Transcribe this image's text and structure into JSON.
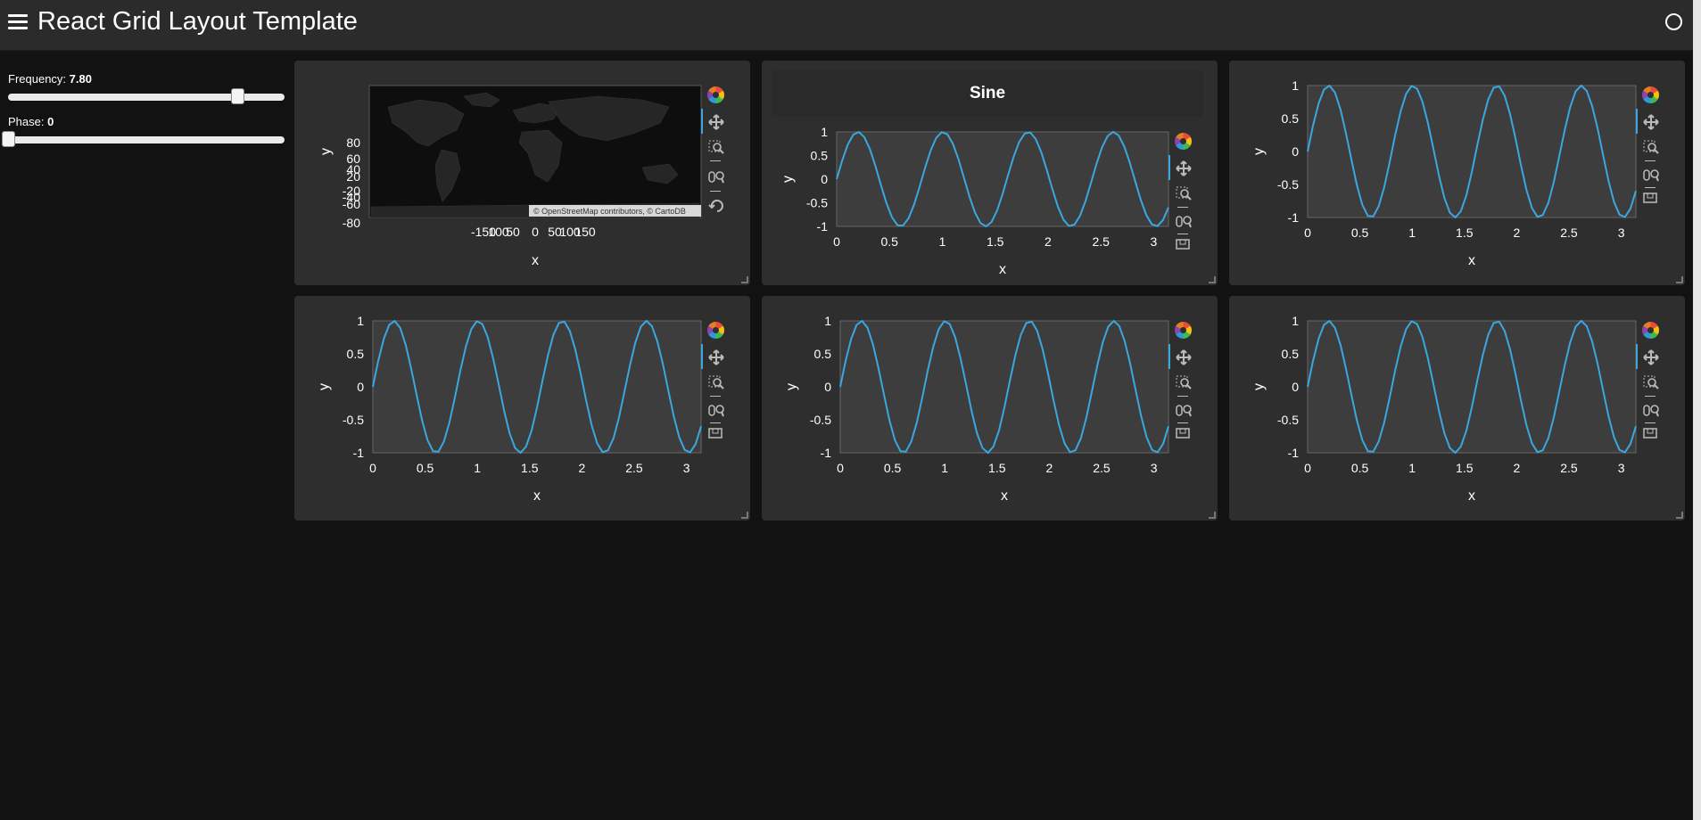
{
  "header": {
    "title": "React Grid Layout Template",
    "menu_icon": "hamburger-menu-icon",
    "status_icon": "busy-indicator-icon"
  },
  "sidebar": {
    "frequency": {
      "label": "Frequency:",
      "value": "7.80",
      "level": 0.83
    },
    "phase": {
      "label": "Phase:",
      "value": "0",
      "level": 0.0
    }
  },
  "colors": {
    "line": "#3ba7e0",
    "card": "#2e2e2e",
    "plot_bg": "#3d3d3d",
    "page_bg": "#121212",
    "header_bg": "#2b2b2b"
  },
  "map_card": {
    "attribution": "© OpenStreetMap contributors, © CartoDB",
    "xlabel": "x",
    "ylabel": "y",
    "xticks": [
      "-150",
      "100",
      "50",
      "0",
      "50",
      "100",
      "150"
    ],
    "yticks": [
      "80",
      "60",
      "40",
      "20",
      "-20",
      "-40",
      "-60",
      "-80"
    ]
  },
  "sine_card": {
    "title": "Sine"
  },
  "chart_data": [
    {
      "type": "line",
      "card": "sine-card",
      "title": "Sine",
      "xlabel": "x",
      "ylabel": "y",
      "frequency": 7.8,
      "phase": 0,
      "xlim": [
        0,
        3.14
      ],
      "ylim": [
        -1,
        1
      ],
      "xticks": [
        "0",
        "0.5",
        "1",
        "1.5",
        "2",
        "2.5",
        "3"
      ],
      "yticks": [
        "1",
        "0.5",
        "0",
        "-0.5",
        "-1"
      ]
    },
    {
      "type": "line",
      "card": "plot-card-3",
      "title": "",
      "xlabel": "x",
      "ylabel": "y",
      "frequency": 7.8,
      "phase": 0,
      "xlim": [
        0,
        3.14
      ],
      "ylim": [
        -1,
        1
      ],
      "xticks": [
        "0",
        "0.5",
        "1",
        "1.5",
        "2",
        "2.5",
        "3"
      ],
      "yticks": [
        "1",
        "0.5",
        "0",
        "-0.5",
        "-1"
      ]
    },
    {
      "type": "line",
      "card": "plot-card-4",
      "title": "",
      "xlabel": "x",
      "ylabel": "y",
      "frequency": 7.8,
      "phase": 0,
      "xlim": [
        0,
        3.14
      ],
      "ylim": [
        -1,
        1
      ],
      "xticks": [
        "0",
        "0.5",
        "1",
        "1.5",
        "2",
        "2.5",
        "3"
      ],
      "yticks": [
        "1",
        "0.5",
        "0",
        "-0.5",
        "-1"
      ]
    },
    {
      "type": "line",
      "card": "plot-card-5",
      "title": "",
      "xlabel": "x",
      "ylabel": "y",
      "frequency": 7.8,
      "phase": 0,
      "xlim": [
        0,
        3.14
      ],
      "ylim": [
        -1,
        1
      ],
      "xticks": [
        "0",
        "0.5",
        "1",
        "1.5",
        "2",
        "2.5",
        "3"
      ],
      "yticks": [
        "1",
        "0.5",
        "0",
        "-0.5",
        "-1"
      ]
    },
    {
      "type": "line",
      "card": "plot-card-6",
      "title": "",
      "xlabel": "x",
      "ylabel": "y",
      "frequency": 7.8,
      "phase": 0,
      "xlim": [
        0,
        3.14
      ],
      "ylim": [
        -1,
        1
      ],
      "xticks": [
        "0",
        "0.5",
        "1",
        "1.5",
        "2",
        "2.5",
        "3"
      ],
      "yticks": [
        "1",
        "0.5",
        "0",
        "-0.5",
        "-1"
      ]
    }
  ],
  "toolbar_icons": [
    "bokeh-logo-icon",
    "pan-icon",
    "box-zoom-icon",
    "wheel-zoom-icon",
    "save-icon",
    "reset-icon"
  ]
}
